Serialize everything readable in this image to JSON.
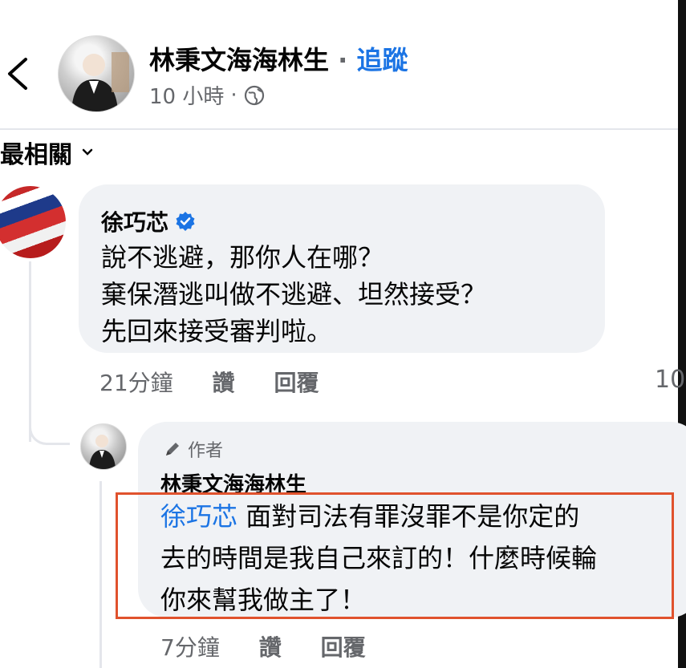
{
  "header": {
    "author_name": "林秉文海海林生",
    "separator": "·",
    "follow_label": "追蹤",
    "time": "10 小時",
    "time_separator": "·",
    "privacy_icon": "globe-icon",
    "back_icon": "chevron-left-icon"
  },
  "sort": {
    "label": "最相關",
    "icon": "chevron-down-icon"
  },
  "comment": {
    "author": "徐巧芯",
    "verified_icon": "verified-badge-icon",
    "lines": [
      "說不逃避，那你人在哪？",
      "棄保潛逃叫做不逃避、坦然接受？",
      "先回來接受審判啦。"
    ],
    "time": "21分鐘",
    "like_label": "讚",
    "reply_label": "回覆",
    "reaction_count_partial": "10"
  },
  "reply": {
    "badge_label": "作者",
    "badge_icon": "pen-icon",
    "author": "林秉文海海林生",
    "mention": "徐巧芯",
    "line1_rest": " 面對司法有罪沒罪不是你定的",
    "line2": "去的時間是我自己來訂的！什麼時候輪",
    "line3": "你來幫我做主了！",
    "time": "7分鐘",
    "like_label": "讚",
    "reply_label": "回覆"
  },
  "colors": {
    "link_blue": "#1b74e4",
    "bubble_gray": "#f0f2f5",
    "meta_gray": "#65676b",
    "highlight_red": "#e0522d"
  }
}
